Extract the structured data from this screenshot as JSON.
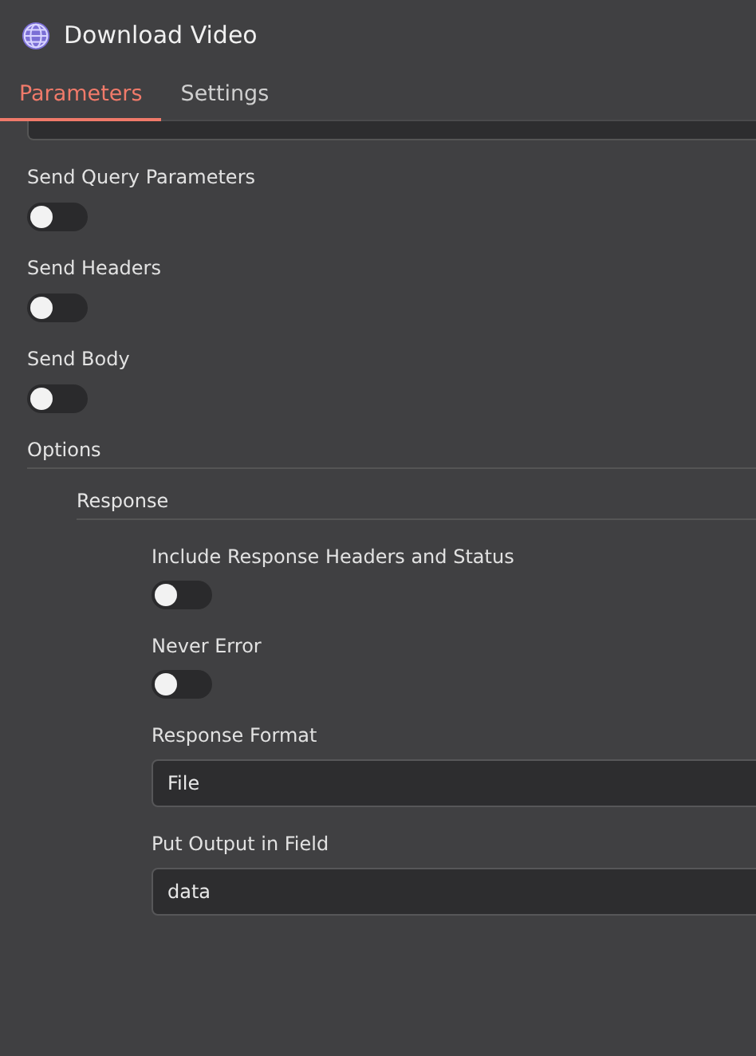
{
  "window": {
    "title": "Download Video"
  },
  "tabs": [
    {
      "label": "Parameters",
      "selected": true
    },
    {
      "label": "Settings",
      "selected": false
    }
  ],
  "parameters": [
    {
      "kind": "toggle",
      "label": "Send Query Parameters",
      "on": false
    },
    {
      "kind": "toggle",
      "label": "Send Headers",
      "on": false
    },
    {
      "kind": "toggle",
      "label": "Send Body",
      "on": false
    }
  ],
  "options": {
    "label": "Options",
    "collection": {
      "label": "Response",
      "fields": [
        {
          "kind": "toggle",
          "label": "Include Response Headers and Status",
          "on": false
        },
        {
          "kind": "toggle",
          "label": "Never Error",
          "on": false
        },
        {
          "kind": "select",
          "label": "Response Format",
          "value": "File"
        },
        {
          "kind": "input",
          "label": "Put Output in Field",
          "value": "data"
        }
      ]
    }
  }
}
